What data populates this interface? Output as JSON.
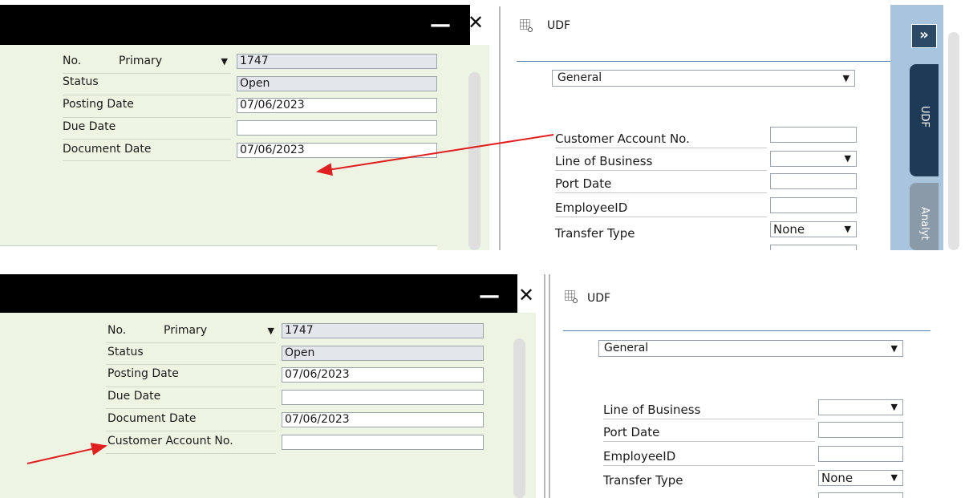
{
  "window": {
    "minimize_glyph": "—",
    "close_glyph": "✕"
  },
  "top": {
    "form": {
      "no_label": "No.",
      "series_value": "Primary",
      "no_value": "1747",
      "status_label": "Status",
      "status_value": "Open",
      "posting_date_label": "Posting Date",
      "posting_date_value": "07/06/2023",
      "due_date_label": "Due Date",
      "due_date_value": "",
      "document_date_label": "Document Date",
      "document_date_value": "07/06/2023"
    },
    "udf": {
      "title": "UDF",
      "category": "General",
      "fields": [
        {
          "label": "Customer Account No.",
          "value": ""
        },
        {
          "label": "Line of Business",
          "value": ""
        },
        {
          "label": "Port Date",
          "value": ""
        },
        {
          "label": "EmployeeID",
          "value": ""
        },
        {
          "label": "Transfer Type",
          "value": "None"
        }
      ],
      "expand_glyph": "»",
      "tab_udf": "UDF",
      "tab_analytics": "Analyt"
    }
  },
  "bottom": {
    "form": {
      "no_label": "No.",
      "series_value": "Primary",
      "no_value": "1747",
      "status_label": "Status",
      "status_value": "Open",
      "posting_date_label": "Posting Date",
      "posting_date_value": "07/06/2023",
      "due_date_label": "Due Date",
      "due_date_value": "",
      "document_date_label": "Document Date",
      "document_date_value": "07/06/2023",
      "customer_account_label": "Customer Account No.",
      "customer_account_value": ""
    },
    "udf": {
      "title": "UDF",
      "category": "General",
      "fields": [
        {
          "label": "Line of Business",
          "value": ""
        },
        {
          "label": "Port Date",
          "value": ""
        },
        {
          "label": "EmployeeID",
          "value": ""
        },
        {
          "label": "Transfer Type",
          "value": "None"
        }
      ]
    }
  },
  "colors": {
    "form_bg": "#edf5e2",
    "readonly_field": "#e3e7ec",
    "annotation_arrow": "#e02020",
    "sidebar": "#a9c4dd",
    "tab_active": "#1f3a57"
  }
}
